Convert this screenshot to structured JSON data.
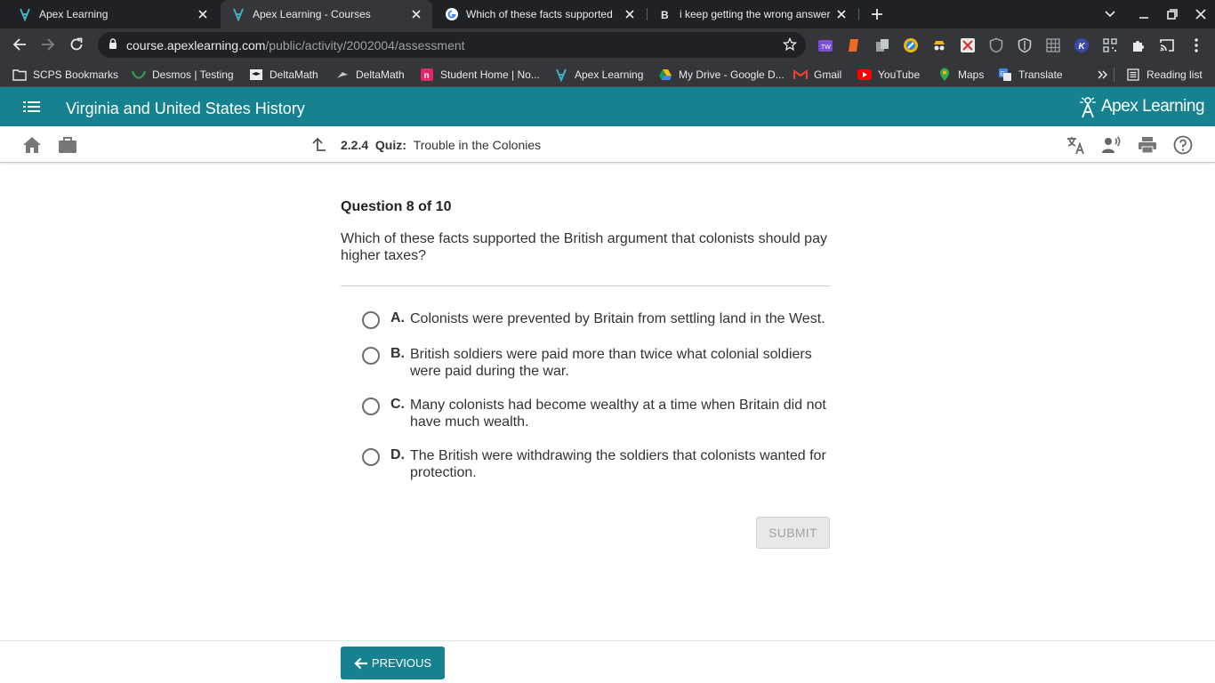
{
  "browser": {
    "tabs": [
      {
        "title": "Apex Learning",
        "active": false
      },
      {
        "title": "Apex Learning - Courses",
        "active": true
      },
      {
        "title": "Which of these facts supported",
        "active": false
      },
      {
        "title": "i keep getting the wrong answer",
        "active": false
      }
    ],
    "url_host": "course.apexlearning.com",
    "url_path": "/public/activity/2002004/assessment",
    "bookmarks": [
      {
        "label": "SCPS Bookmarks",
        "icon": "folder-icon"
      },
      {
        "label": "Desmos | Testing",
        "icon": "desmos-icon"
      },
      {
        "label": "DeltaMath",
        "icon": "graduation-cap-icon"
      },
      {
        "label": "DeltaMath",
        "icon": "deltamath-icon"
      },
      {
        "label": "Student Home | No...",
        "icon": "noredink-icon"
      },
      {
        "label": "Apex Learning",
        "icon": "apex-icon"
      },
      {
        "label": "My Drive - Google D...",
        "icon": "google-drive-icon"
      },
      {
        "label": "Gmail",
        "icon": "gmail-icon"
      },
      {
        "label": "YouTube",
        "icon": "youtube-icon"
      },
      {
        "label": "Maps",
        "icon": "maps-icon"
      },
      {
        "label": "Translate",
        "icon": "translate-icon"
      }
    ],
    "reading_list": "Reading list"
  },
  "course": {
    "title": "Virginia and United States History",
    "logo_text": "Apex Learning"
  },
  "activity": {
    "number": "2.2.4",
    "type": "Quiz:",
    "title": "Trouble in the Colonies"
  },
  "question": {
    "header": "Question 8 of 10",
    "text": "Which of these facts supported the British argument that colonists should pay higher taxes?",
    "options": [
      {
        "letter": "A.",
        "text": "Colonists were prevented by Britain from settling land in the West."
      },
      {
        "letter": "B.",
        "text": "British soldiers were paid more than twice what colonial soldiers were paid during the war."
      },
      {
        "letter": "C.",
        "text": "Many colonists had become wealthy at a time when Britain did not have much wealth."
      },
      {
        "letter": "D.",
        "text": "The British were withdrawing the soldiers that colonists wanted for protection."
      }
    ],
    "submit_label": "SUBMIT"
  },
  "footer": {
    "previous_label": "PREVIOUS"
  },
  "colors": {
    "apex_teal": "#16818f",
    "chrome_dark": "#202124",
    "chrome_toolbar": "#35363a"
  }
}
